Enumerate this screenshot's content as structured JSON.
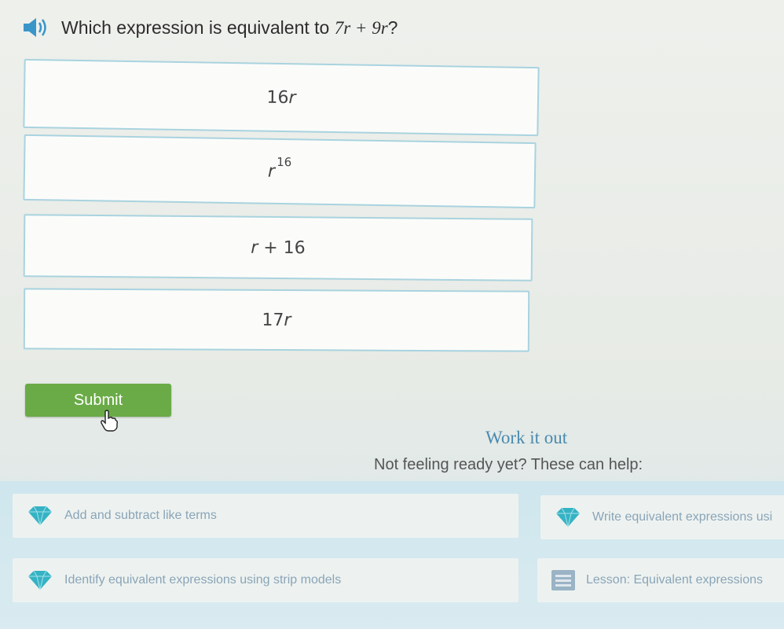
{
  "question": {
    "prefix": "Which expression is equivalent to ",
    "expression": "7r + 9r",
    "suffix": "?",
    "audio_icon": "speaker-icon"
  },
  "choices": [
    {
      "coef": "16",
      "var": "r"
    },
    {
      "var": "r",
      "exponent": "16"
    },
    {
      "var": "r",
      "rest": " + 16"
    },
    {
      "coef": "17",
      "var": "r"
    }
  ],
  "submit_label": "Submit",
  "work_it_out": {
    "title": "Work it out",
    "subtitle": "Not feeling ready yet? These can help:"
  },
  "resources": [
    {
      "label": "Add and subtract like terms",
      "icon": "diamond-icon"
    },
    {
      "label": "Write equivalent expressions usi",
      "icon": "diamond-icon"
    },
    {
      "label": "Identify equivalent expressions using strip models",
      "icon": "diamond-icon"
    },
    {
      "label": "Lesson: Equivalent expressions",
      "icon": "lesson-icon"
    }
  ],
  "colors": {
    "submit": "#6aab47",
    "choice_border": "#a9d3df",
    "work_title": "#4a8ab0",
    "gem": "#35b3c4"
  }
}
